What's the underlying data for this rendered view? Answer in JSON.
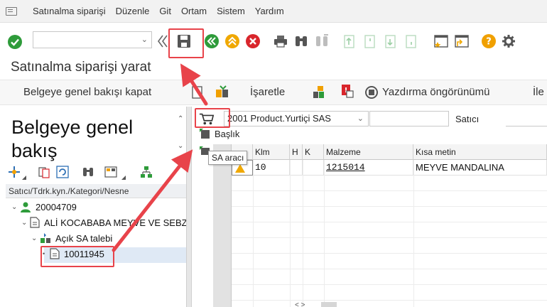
{
  "menu": {
    "items": [
      "Satınalma siparişi",
      "Düzenle",
      "Git",
      "Ortam",
      "Sistem",
      "Yardım"
    ]
  },
  "toolbar": {
    "command_value": "",
    "icons": [
      "enter-icon",
      "command-dropdown-icon",
      "collapse-icon",
      "save-icon",
      "back-icon",
      "exit-icon",
      "cancel-icon",
      "print-icon",
      "find-icon",
      "find-next-icon",
      "first-page-icon",
      "previous-page-icon",
      "next-page-icon",
      "last-page-icon",
      "create-session-icon",
      "shortcut-icon",
      "help-icon",
      "settings-icon"
    ]
  },
  "page_title": "Satınalma siparişi yarat",
  "app_toolbar": {
    "overview_button": "Belgeye genel bakışı kapat",
    "mark_button": "İşaretle",
    "print_preview_button": "Yazdırma öngörünümü",
    "more_button": "İle"
  },
  "left_panel": {
    "title": "Belgeye genel bakış",
    "tree_header": "Satıcı/Tdrk.kyn./Kategori/Nesne",
    "tree": {
      "vendor_id": "20004709",
      "vendor_name": "ALİ KOCABABA MEYVE VE SEBZE",
      "folder": "Açık SA talebi",
      "document": "10011945"
    }
  },
  "right_panel": {
    "doc_type": "2001 Product.Yurtiçi SAS",
    "vendor_label": "Satıcı",
    "vendor_value": "",
    "header_label": "Başlık",
    "tooltip": "SA aracı",
    "grid": {
      "columns": [
        "Klm",
        "H",
        "K",
        "Malzeme",
        "Kısa metin"
      ],
      "rows": [
        {
          "klm": "10",
          "h": "",
          "k": "",
          "malzeme": "1215014",
          "kisa_metin": "MEYVE MANDALINA"
        }
      ]
    }
  },
  "colors": {
    "highlight": "#e8434a",
    "ok_green": "#2e9b3a",
    "back_green": "#2e9b3a",
    "exit_yellow": "#f0a800",
    "cancel_red": "#d9262c",
    "help_orange": "#f0a000",
    "selected_row": "#dfe9f5"
  }
}
